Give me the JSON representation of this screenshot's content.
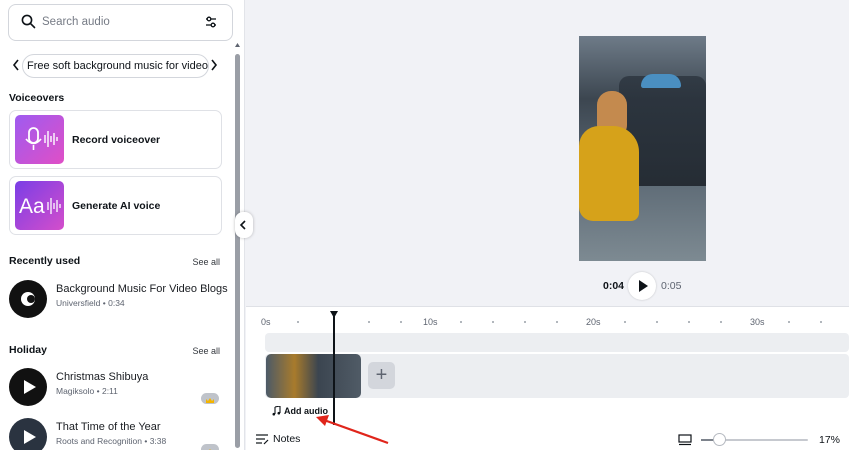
{
  "search": {
    "placeholder": "Search audio"
  },
  "chip": {
    "label": "Free soft background music for video"
  },
  "voiceovers": {
    "title": "Voiceovers",
    "items": [
      {
        "label": "Record voiceover",
        "icon": "microphone-icon"
      },
      {
        "label": "Generate AI voice",
        "icon": "ai-voice-icon"
      }
    ]
  },
  "recently_used": {
    "title": "Recently used",
    "see_all": "See all",
    "tracks": [
      {
        "title": "Background Music For Video Blogs",
        "subtitle": "Universfield • 0:34"
      }
    ]
  },
  "holiday": {
    "title": "Holiday",
    "see_all": "See all",
    "tracks": [
      {
        "title": "Christmas Shibuya",
        "subtitle": "Magiksolo • 2:11"
      },
      {
        "title": "That Time of the Year",
        "subtitle": "Roots and Recognition • 3:38"
      }
    ]
  },
  "player": {
    "current": "0:04",
    "duration": "0:05"
  },
  "timeline": {
    "ticks": [
      "0s",
      "10s",
      "20s",
      "30s"
    ],
    "add_audio": "Add audio",
    "add_clip": "+"
  },
  "footer": {
    "notes": "Notes",
    "zoom": "17%",
    "zoom_level": 0.17
  },
  "colors": {
    "accent": "#8b3dff",
    "annotation_arrow": "#e0251b"
  }
}
